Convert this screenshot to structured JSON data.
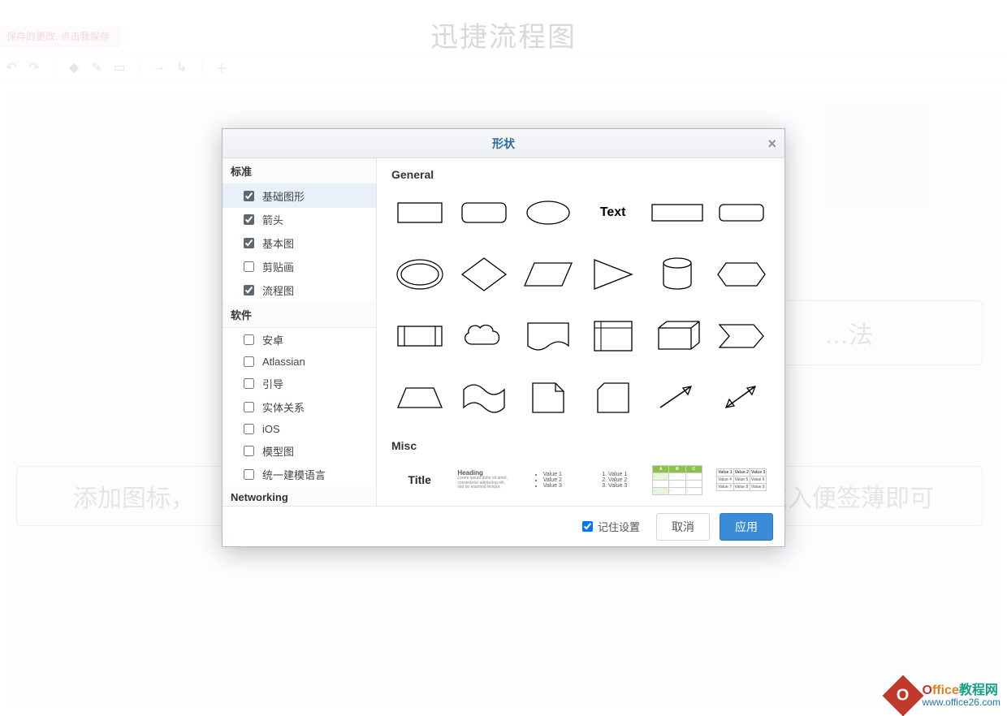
{
  "app": {
    "title": "迅捷流程图"
  },
  "banner": {
    "text": "保存的更改. 点击我保存."
  },
  "canvas": {
    "node_left": "添加图标，",
    "node_right_1": "…法",
    "node_right_2": "拖入便签薄即可"
  },
  "modal": {
    "title": "形状",
    "close": "×",
    "sections": [
      {
        "label": "标准",
        "items": [
          {
            "label": "基础图形",
            "checked": true,
            "selected": true
          },
          {
            "label": "箭头",
            "checked": true
          },
          {
            "label": "基本图",
            "checked": true
          },
          {
            "label": "剪贴画",
            "checked": false
          },
          {
            "label": "流程图",
            "checked": true
          }
        ]
      },
      {
        "label": "软件",
        "items": [
          {
            "label": "安卓",
            "checked": false
          },
          {
            "label": "Atlassian",
            "checked": false
          },
          {
            "label": "引导",
            "checked": false
          },
          {
            "label": "实体关系",
            "checked": false
          },
          {
            "label": "iOS",
            "checked": false
          },
          {
            "label": "模型图",
            "checked": false
          },
          {
            "label": "统一建模语言",
            "checked": false
          }
        ]
      },
      {
        "label": "Networking",
        "items": []
      }
    ],
    "groups": {
      "general": "General",
      "misc": "Misc",
      "text_shape": "Text"
    },
    "misc_samples": {
      "title": "Title",
      "heading": "Heading",
      "lorem": "Lorem ipsum dolor sit amet, consectetur adipiscing elit, sed do eiusmod tempor.",
      "bullet": [
        "Value 1",
        "Value 2",
        "Value 3"
      ],
      "numbered": [
        "Value 1",
        "Value 2",
        "Value 3"
      ],
      "table_headers": [
        "Value 1",
        "Value 2",
        "Value 3"
      ]
    },
    "footer": {
      "remember": "记住设置",
      "cancel": "取消",
      "apply": "应用"
    }
  },
  "watermark": {
    "brand_prefix": "Office",
    "brand_suffix": "教程网",
    "url": "www.office26.com"
  }
}
